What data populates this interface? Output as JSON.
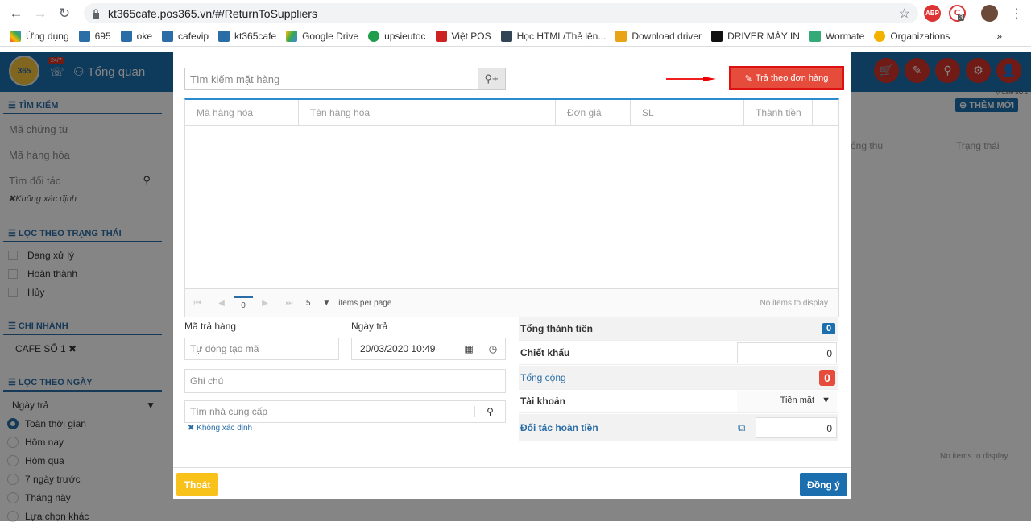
{
  "browser": {
    "url": "kt365cafe.pos365.vn/#/ReturnToSuppliers",
    "bookmarks": [
      "Ứng dụng",
      "695",
      "oke",
      "cafevip",
      "kt365cafe",
      "Google Drive",
      "upsieutoc",
      "Việt POS",
      "Học HTML/Thẻ lện...",
      "Download driver",
      "DRIVER MÁY IN",
      "Wormate",
      "Organizations"
    ],
    "ext_badge": "3"
  },
  "header": {
    "logo": "365",
    "badge": "24/7",
    "nav_label": "Tổng quan"
  },
  "sidebar": {
    "search_title": "TÌM KIẾM",
    "search_fields": [
      "Mã chứng từ",
      "Mã hàng hóa",
      "Tìm đối tác"
    ],
    "unspecified": "Không xác định",
    "status_title": "LỌC THEO TRẠNG THÁI",
    "statuses": [
      "Đang xử lý",
      "Hoàn thành",
      "Hủy"
    ],
    "branch_title": "CHI NHÁNH",
    "branch": "CAFE SỐ 1",
    "date_title": "LỌC THEO NGÀY",
    "date_select": "Ngày trả",
    "date_options": [
      "Toàn thời gian",
      "Hôm nay",
      "Hôm qua",
      "7 ngày trước",
      "Tháng này",
      "Lựa chọn khác"
    ]
  },
  "right_panel": {
    "branch_tag": "Cafe SỐ 1",
    "add_new": "THÊM MỚI",
    "col_total": "ổng thu",
    "col_status": "Trạng thái",
    "empty": "No items to display"
  },
  "modal": {
    "search_placeholder": "Tìm kiếm mặt hàng",
    "return_by_order": "Trả theo đơn hàng",
    "columns": [
      "Mã hàng hóa",
      "Tên hàng hóa",
      "Đơn giá",
      "SL",
      "Thành tiền"
    ],
    "pager": {
      "page": "0",
      "page_size": "5",
      "items_per_page": "items per page",
      "empty": "No items to display"
    },
    "return_code_label": "Mã trả hàng",
    "return_code_placeholder": "Tự động tạo mã",
    "return_date_label": "Ngày trả",
    "return_date_value": "20/03/2020 10:49",
    "note_placeholder": "Ghi chú",
    "supplier_placeholder": "Tìm nhà cung cấp",
    "unspecified": "Không xác định",
    "summary": {
      "total_amount_label": "Tổng thành tiền",
      "total_amount": "0",
      "discount_label": "Chiết khấu",
      "discount": "0",
      "grand_total_label": "Tổng cộng",
      "grand_total": "0",
      "account_label": "Tài khoản",
      "account": "Tiền mặt",
      "refund_label": "Đối tác hoàn tiền",
      "refund": "0"
    },
    "exit_label": "Thoát",
    "ok_label": "Đồng ý"
  },
  "colors": {
    "primary": "#1b6fae",
    "danger": "#e64c3c",
    "warning": "#f9c21b"
  }
}
